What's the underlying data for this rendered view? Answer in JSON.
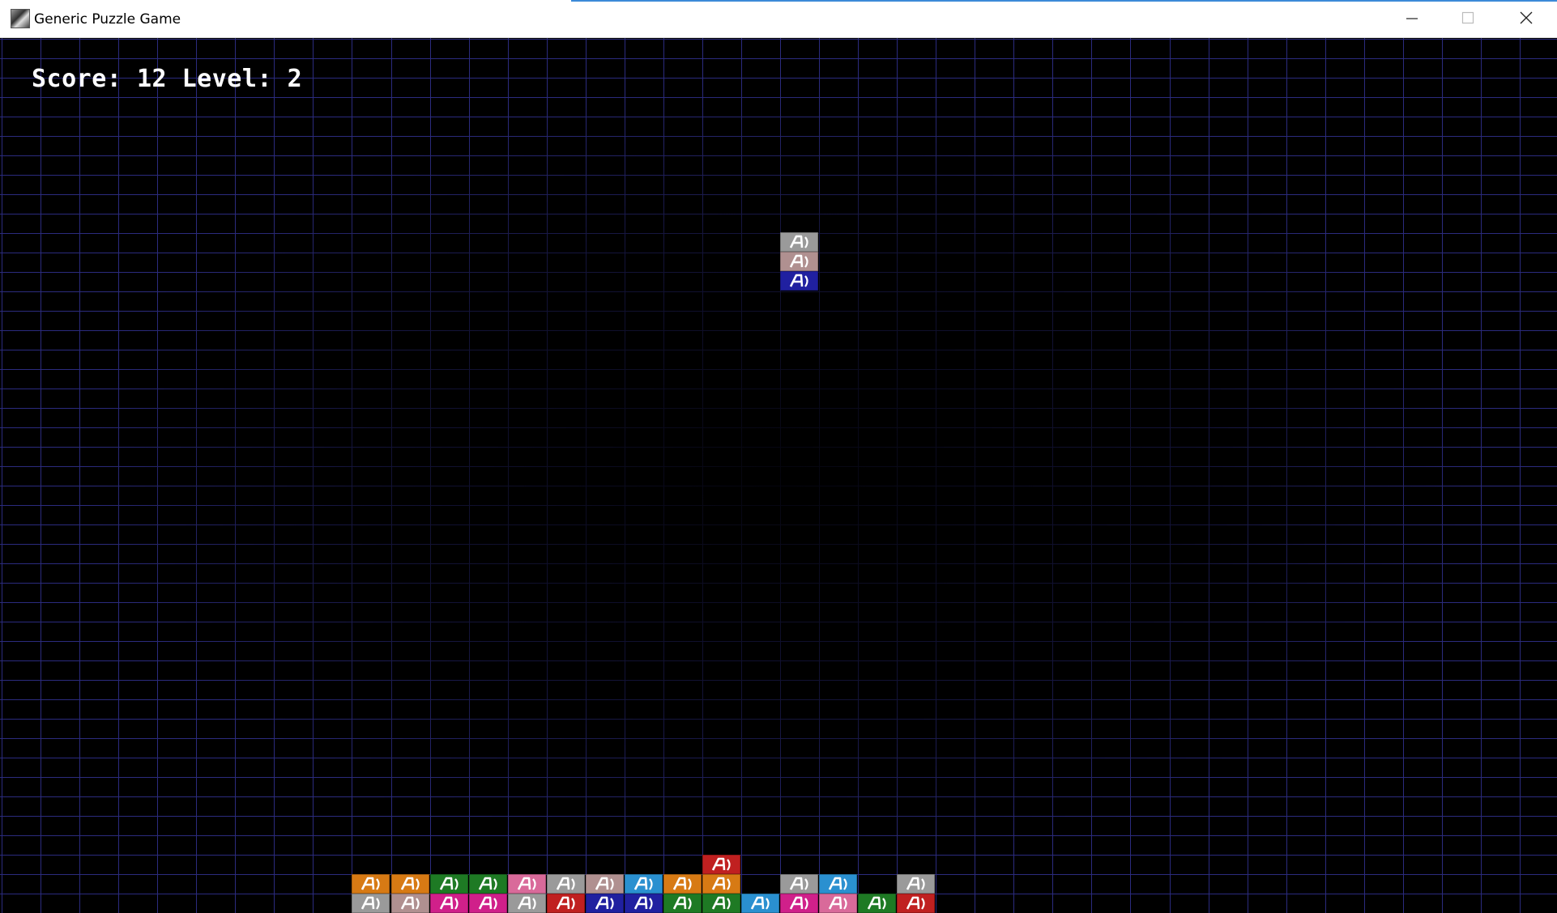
{
  "window": {
    "title": "Generic Puzzle Game",
    "icon": "app-icon",
    "buttons": {
      "minimize": "minimize-icon",
      "maximize": "maximize-icon",
      "close": "close-icon"
    }
  },
  "hud": {
    "score_label": "Score:",
    "score": 12,
    "level_label": "Level:",
    "level": 2
  },
  "palette": {
    "orange": "#d77a14",
    "green": "#1e7a24",
    "pink": "#d96a9a",
    "silver": "#9a9a9a",
    "mauve": "#b09090",
    "cyan": "#2a90d0",
    "red": "#c02020",
    "magenta": "#d0208a",
    "blue": "#2020a0",
    "grid": "#3a3aa8",
    "background": "#000000"
  },
  "board": {
    "columns": 40,
    "falling_piece": {
      "column": 20,
      "blocks": [
        "silver",
        "mauve",
        "blue"
      ]
    },
    "stack": {
      "row_top": [
        {
          "col": 18,
          "color": "red"
        }
      ],
      "row_upper": [
        {
          "col": 9,
          "color": "orange"
        },
        {
          "col": 10,
          "color": "orange"
        },
        {
          "col": 11,
          "color": "green"
        },
        {
          "col": 12,
          "color": "green"
        },
        {
          "col": 13,
          "color": "pink"
        },
        {
          "col": 14,
          "color": "silver"
        },
        {
          "col": 15,
          "color": "mauve"
        },
        {
          "col": 16,
          "color": "cyan"
        },
        {
          "col": 17,
          "color": "orange"
        },
        {
          "col": 18,
          "color": "orange"
        },
        {
          "col": 20,
          "color": "silver"
        },
        {
          "col": 21,
          "color": "cyan"
        },
        {
          "col": 23,
          "color": "silver"
        }
      ],
      "row_lower": [
        {
          "col": 9,
          "color": "silver"
        },
        {
          "col": 10,
          "color": "mauve"
        },
        {
          "col": 11,
          "color": "magenta"
        },
        {
          "col": 12,
          "color": "magenta"
        },
        {
          "col": 13,
          "color": "silver"
        },
        {
          "col": 14,
          "color": "red"
        },
        {
          "col": 15,
          "color": "blue"
        },
        {
          "col": 16,
          "color": "blue"
        },
        {
          "col": 17,
          "color": "green"
        },
        {
          "col": 18,
          "color": "green"
        },
        {
          "col": 19,
          "color": "cyan"
        },
        {
          "col": 20,
          "color": "magenta"
        },
        {
          "col": 21,
          "color": "pink"
        },
        {
          "col": 22,
          "color": "green"
        },
        {
          "col": 23,
          "color": "red"
        }
      ]
    }
  }
}
